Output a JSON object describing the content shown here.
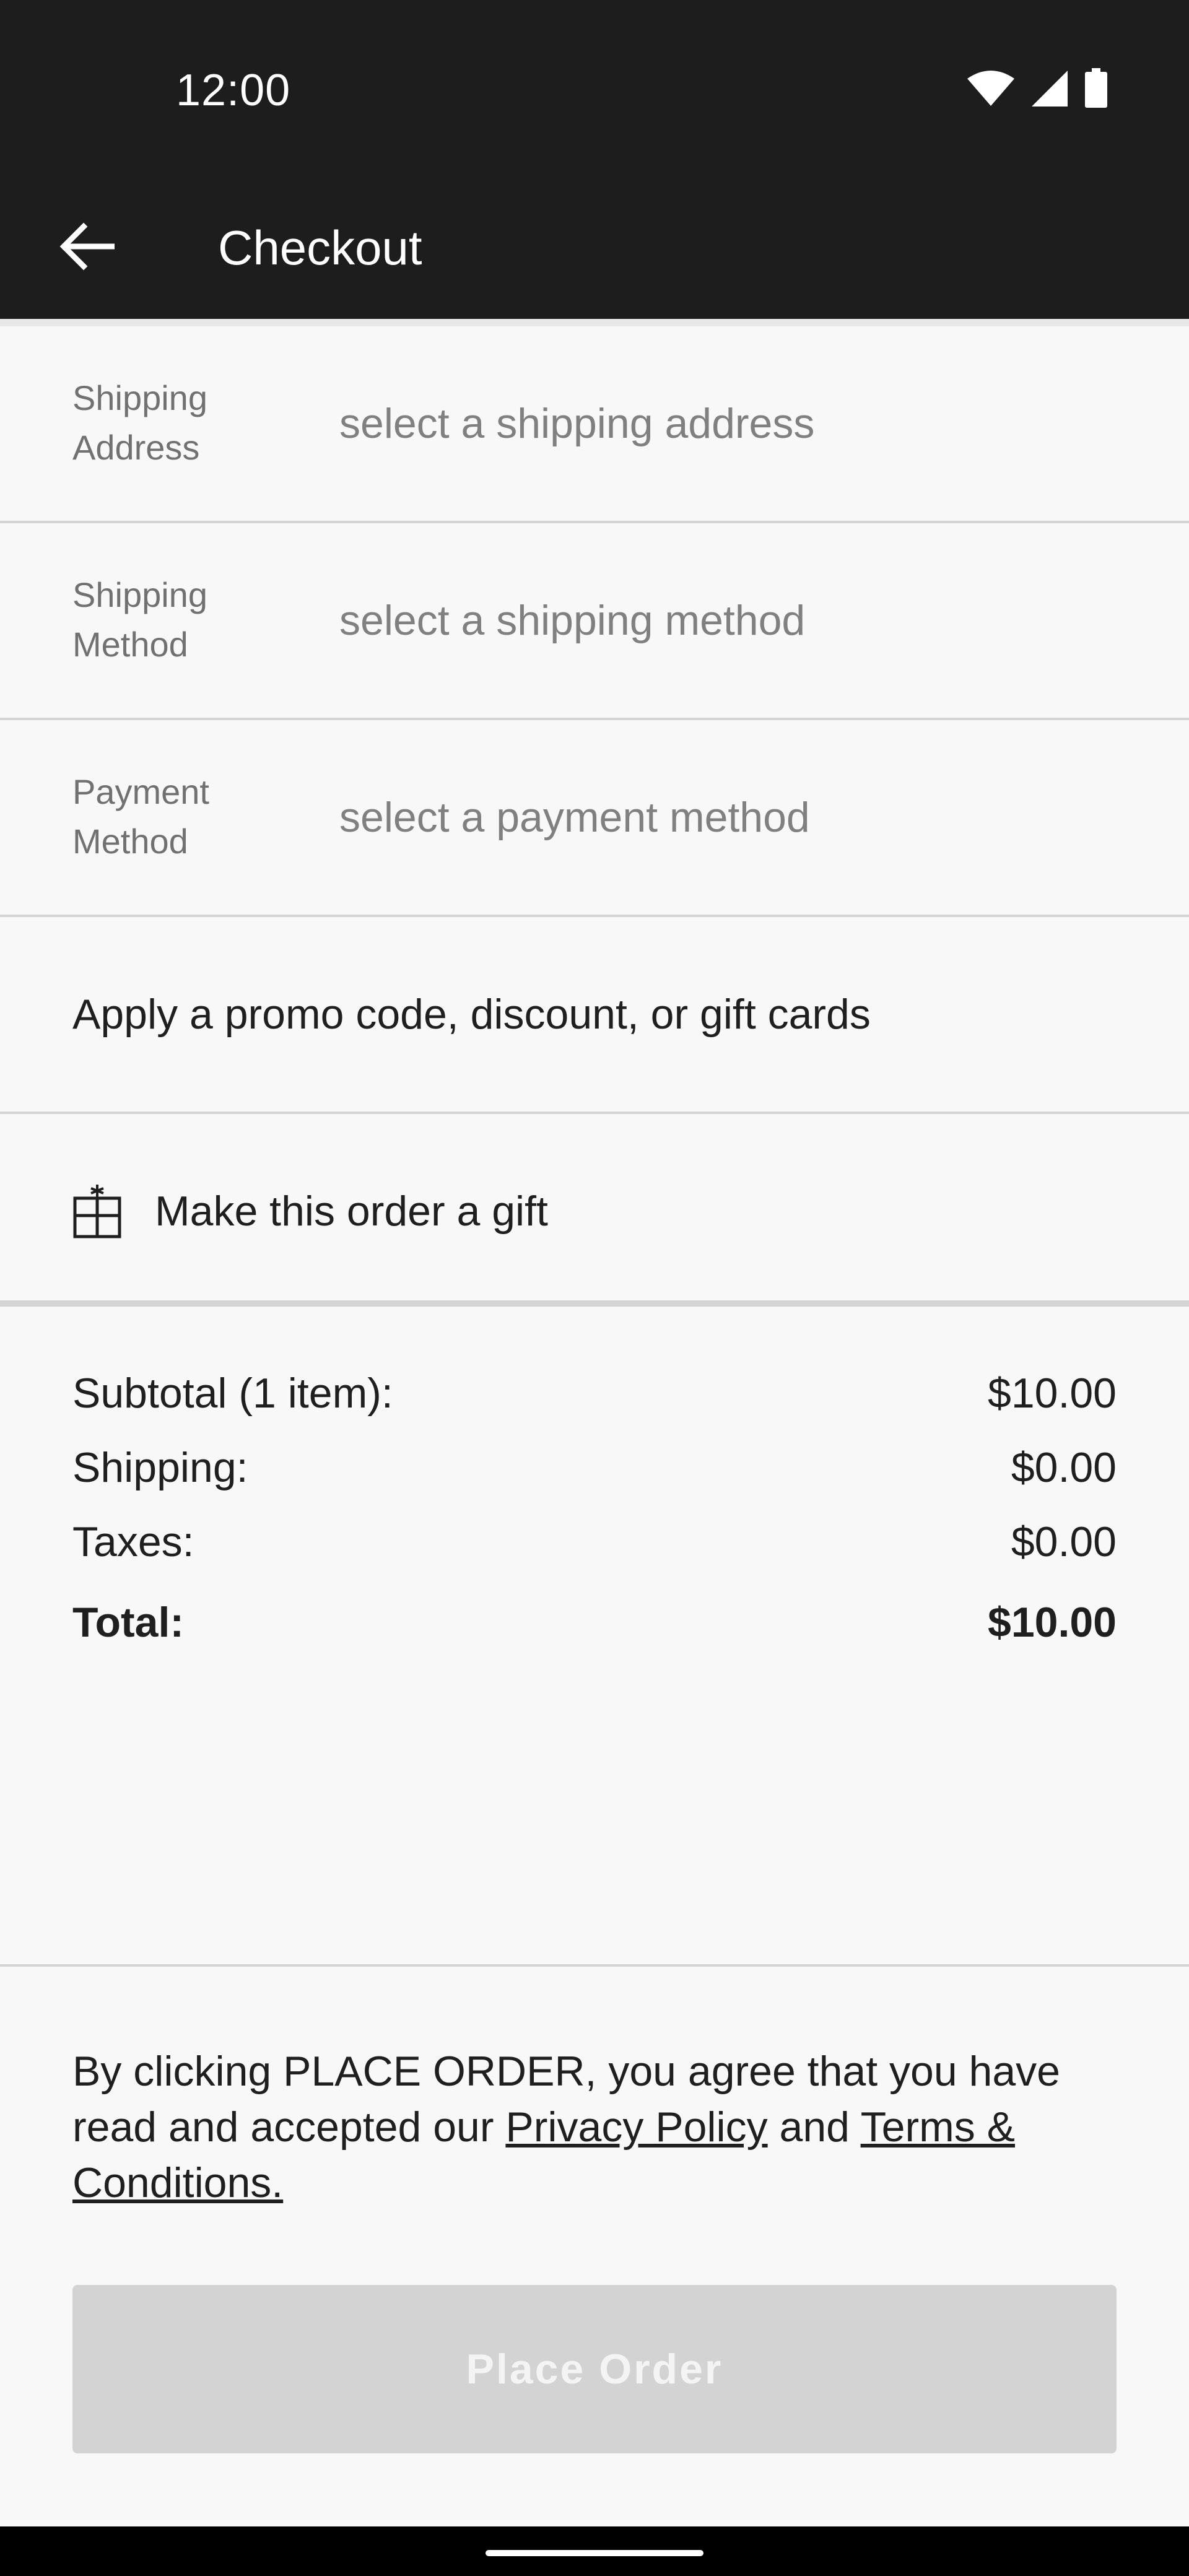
{
  "status_bar": {
    "time": "12:00",
    "icons": [
      "wifi-icon",
      "cellular-signal-icon",
      "battery-icon"
    ]
  },
  "app_bar": {
    "back_icon": "arrow-left-icon",
    "title": "Checkout"
  },
  "checkout_rows": [
    {
      "label_line1": "Shipping",
      "label_line2": "Address",
      "placeholder": "select a shipping address"
    },
    {
      "label_line1": "Shipping",
      "label_line2": "Method",
      "placeholder": "select a shipping method"
    },
    {
      "label_line1": "Payment",
      "label_line2": "Method",
      "placeholder": "select a payment method"
    }
  ],
  "promo": {
    "label": "Apply a promo code, discount, or gift cards"
  },
  "gift": {
    "icon": "gift-icon",
    "label": "Make this order a gift"
  },
  "summary": {
    "subtotal_label": "Subtotal (1 item):",
    "subtotal_value": "$10.00",
    "shipping_label": "Shipping:",
    "shipping_value": "$0.00",
    "taxes_label": "Taxes:",
    "taxes_value": "$0.00",
    "total_label": "Total:",
    "total_value": "$10.00"
  },
  "terms": {
    "prefix": "By clicking PLACE ORDER, you agree that you have read and accepted our ",
    "privacy_link": "Privacy Policy",
    "conjunction": " and ",
    "terms_link": "Terms & Conditions."
  },
  "place_order": {
    "label": "Place Order",
    "enabled": false
  },
  "colors": {
    "bar_background": "#1d1d1d",
    "page_background": "#f8f8f8",
    "button_disabled": "#d3d3d3",
    "divider": "#d4d4d4"
  }
}
